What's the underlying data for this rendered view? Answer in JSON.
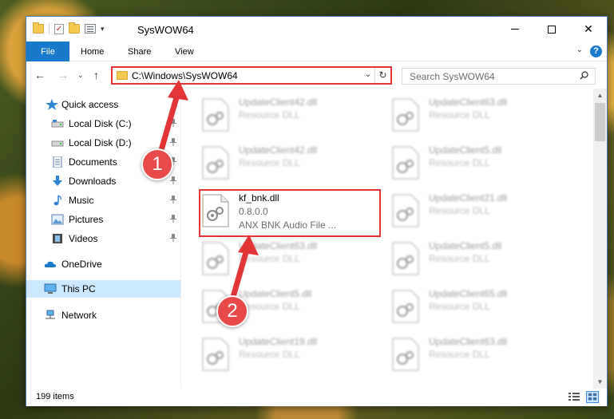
{
  "window": {
    "title": "SysWOW64",
    "controls": {
      "minimize": "minimize",
      "maximize": "maximize",
      "close": "✕"
    }
  },
  "ribbon": {
    "tabs": [
      {
        "label": "File"
      },
      {
        "label": "Home"
      },
      {
        "label": "Share"
      },
      {
        "label": "View"
      }
    ],
    "help": "?"
  },
  "nav": {
    "address": "C:\\Windows\\SysWOW64",
    "search_placeholder": "Search SysWOW64"
  },
  "sidebar": {
    "items": [
      {
        "label": "Quick access",
        "icon": "star-icon"
      },
      {
        "label": "Local Disk (C:)",
        "icon": "drive-icon",
        "pinned": true
      },
      {
        "label": "Local Disk (D:)",
        "icon": "drive-icon",
        "pinned": true
      },
      {
        "label": "Documents",
        "icon": "documents-icon",
        "pinned": true
      },
      {
        "label": "Downloads",
        "icon": "download-icon",
        "pinned": true
      },
      {
        "label": "Music",
        "icon": "music-icon",
        "pinned": true
      },
      {
        "label": "Pictures",
        "icon": "pictures-icon",
        "pinned": true
      },
      {
        "label": "Videos",
        "icon": "videos-icon",
        "pinned": true
      },
      {
        "label": "OneDrive",
        "icon": "cloud-icon"
      },
      {
        "label": "This PC",
        "icon": "computer-icon",
        "selected": true
      },
      {
        "label": "Network",
        "icon": "network-icon"
      }
    ]
  },
  "files": {
    "left": [
      {
        "name": "UpdateClient42.dll",
        "type": "Resource DLL"
      },
      {
        "name": "UpdateClient42.dll",
        "type": "Resource DLL"
      },
      {
        "name": "kf_bnk.dll",
        "version": "0.8.0.0",
        "type": "ANX BNK Audio File ...",
        "highlighted": true
      },
      {
        "name": "UpdateClient63.dll",
        "type": "Resource DLL"
      },
      {
        "name": "UpdateClient5.dll",
        "type": "Resource DLL"
      },
      {
        "name": "UpdateClient19.dll",
        "type": "Resource DLL"
      }
    ],
    "right": [
      {
        "name": "UpdateClient63.dll",
        "type": "Resource DLL"
      },
      {
        "name": "UpdateClient5.dll",
        "type": "Resource DLL"
      },
      {
        "name": "UpdateClient21.dll",
        "type": "Resource DLL"
      },
      {
        "name": "UpdateClient5.dll",
        "type": "Resource DLL"
      },
      {
        "name": "UpdateClient65.dll",
        "type": "Resource DLL"
      },
      {
        "name": "UpdateClient63.dll",
        "type": "Resource DLL"
      }
    ]
  },
  "status": {
    "item_count": "199 items"
  },
  "annotations": {
    "step1": "1",
    "step2": "2",
    "color": "#e23535"
  },
  "colors": {
    "accent": "#1979ca",
    "selection": "#cce8ff",
    "annotation": "#e84a4a"
  }
}
